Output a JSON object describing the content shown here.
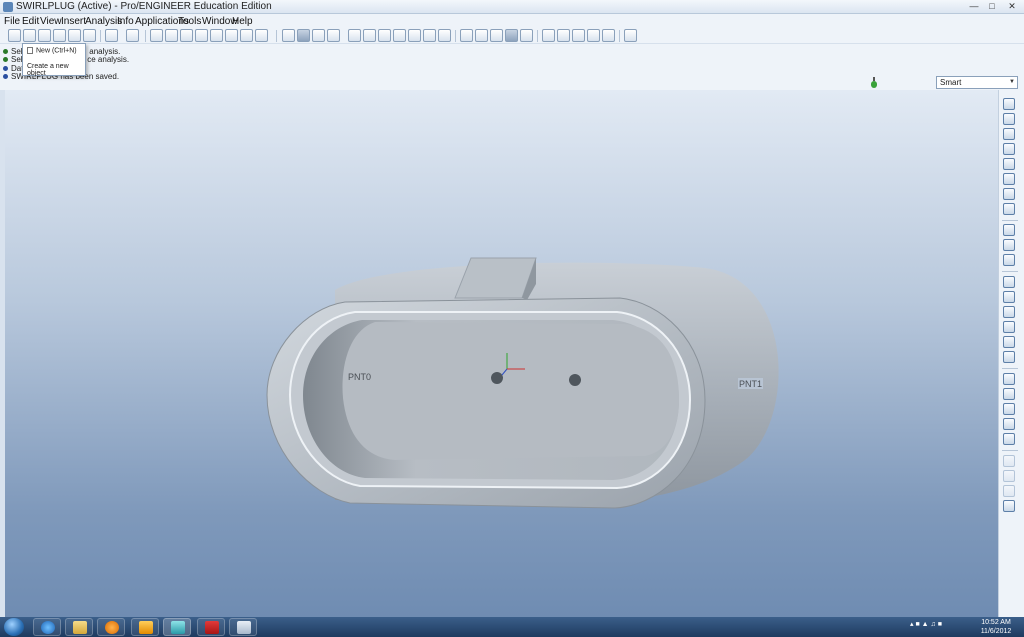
{
  "window": {
    "title": "SWIRLPLUG (Active) - Pro/ENGINEER Education Edition"
  },
  "menu": [
    "File",
    "Edit",
    "View",
    "Insert",
    "Analysis",
    "Info",
    "Applications",
    "Tools",
    "Window",
    "Help"
  ],
  "popup": {
    "item": "New (Ctrl+N)",
    "tooltip": "Create a new object"
  },
  "messages": [
    "Sele",
    "Sele",
    "Datu",
    "SWIRLPLUG has been saved."
  ],
  "message_suffixes": [
    "analysis.",
    "ce analysis."
  ],
  "filter": {
    "selected": "Smart"
  },
  "model": {
    "datum_points": [
      "PNT0",
      "PNT1"
    ]
  },
  "taskbar": {
    "apps": [
      "internet-explorer",
      "file-explorer",
      "media-player",
      "outlook",
      "proengineer",
      "acrobat",
      "notepad"
    ],
    "clock_time": "10:52 AM",
    "clock_date": "11/6/2012"
  },
  "colors": {
    "viewport_top": "#e2eaf4",
    "viewport_bottom": "#6f8cb2",
    "part": "#aeb6bf"
  }
}
